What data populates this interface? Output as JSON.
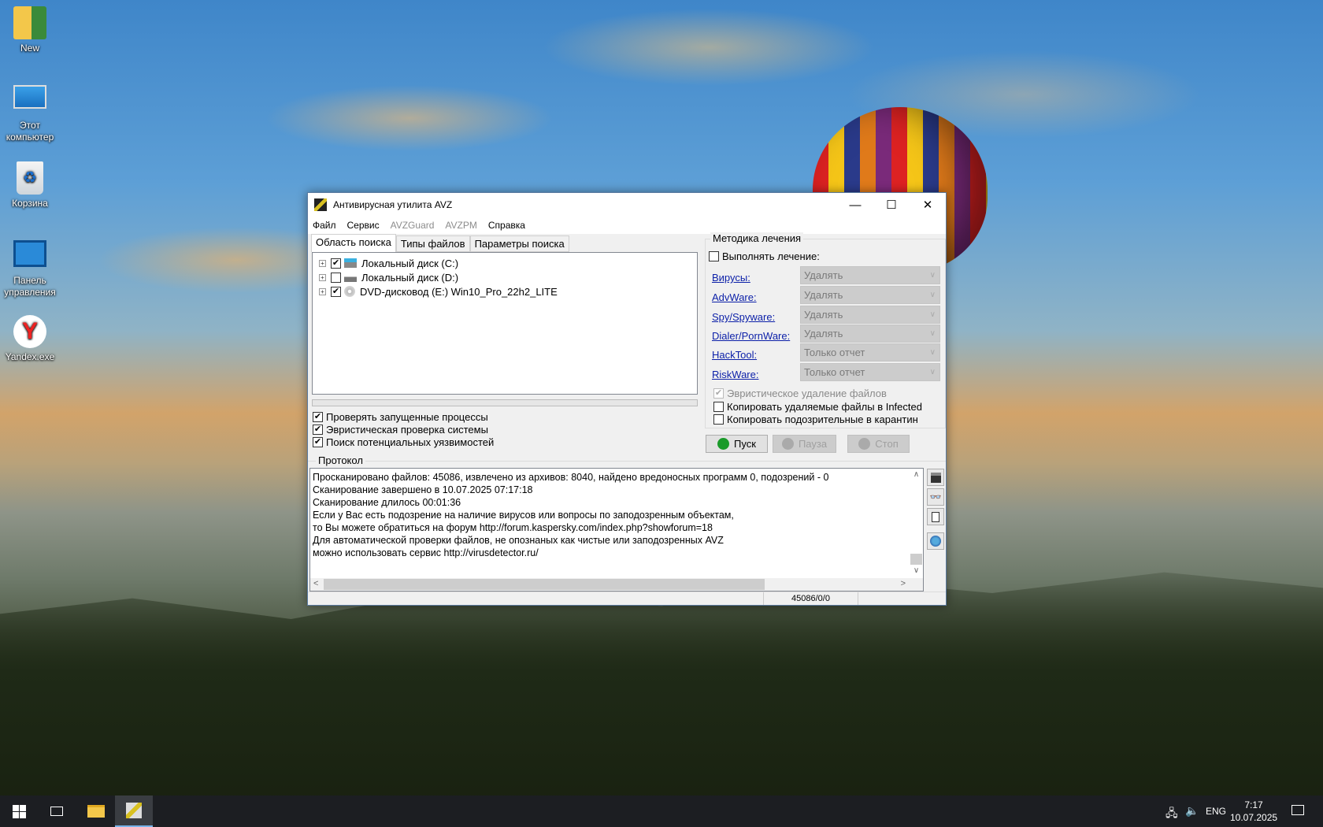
{
  "desktop": {
    "icons": [
      {
        "label": "New",
        "icon": "user-folder-icon"
      },
      {
        "label": "Этот компьютер",
        "icon": "computer-icon"
      },
      {
        "label": "Корзина",
        "icon": "recycle-bin-icon"
      },
      {
        "label": "Панель управления",
        "icon": "control-panel-icon"
      },
      {
        "label": "Yandex.exe",
        "icon": "yandex-installer-icon"
      }
    ]
  },
  "window": {
    "title": "Антивирусная утилита AVZ",
    "menu": [
      "Файл",
      "Сервис",
      "AVZGuard",
      "AVZPM",
      "Справка"
    ],
    "tabs": [
      "Область поиска",
      "Типы файлов",
      "Параметры поиска"
    ],
    "tree": [
      {
        "label": "Локальный диск (C:)",
        "checked": true
      },
      {
        "label": "Локальный диск (D:)",
        "checked": false
      },
      {
        "label": "DVD-дисковод (E:) Win10_Pro_22h2_LITE",
        "checked": true
      }
    ],
    "progress": 0,
    "options": [
      "Проверять запущенные процессы",
      "Эвристическая проверка системы",
      "Поиск потенциальных уязвимостей"
    ],
    "treatment": {
      "title": "Методика лечения",
      "perform": "Выполнять лечение:",
      "rows": [
        {
          "label": "Вирусы:",
          "value": "Удалять"
        },
        {
          "label": "AdvWare:",
          "value": "Удалять"
        },
        {
          "label": "Spy/Spyware:",
          "value": "Удалять"
        },
        {
          "label": "Dialer/PornWare:",
          "value": "Удалять"
        },
        {
          "label": "HackTool:",
          "value": "Только отчет"
        },
        {
          "label": "RiskWare:",
          "value": "Только отчет"
        }
      ],
      "heuristic": "Эвристическое удаление файлов",
      "copy_infected": "Копировать удаляемые файлы в  Infected",
      "copy_quarantine": "Копировать подозрительные в  карантин"
    },
    "buttons": {
      "start": "Пуск",
      "pause": "Пауза",
      "stop": "Стоп"
    },
    "protocol": {
      "title": "Протокол",
      "lines": [
        "Просканировано файлов: 45086, извлечено из архивов: 8040, найдено вредоносных программ 0, подозрений - 0",
        "Сканирование завершено в 10.07.2025 07:17:18",
        "Сканирование длилось 00:01:36",
        "Если у Вас есть подозрение на наличие вирусов или вопросы по заподозренным объектам,",
        "то Вы можете обратиться на форум http://forum.kaspersky.com/index.php?showforum=18",
        "Для автоматической проверки файлов, не опознаных как чистые или заподозренных AVZ",
        "можно использовать сервис http://virusdetector.ru/"
      ]
    },
    "status": "45086/0/0"
  },
  "taskbar": {
    "lang": "ENG",
    "time": "7:17",
    "date": "10.07.2025"
  },
  "colors": {
    "link": "#0b1fa8",
    "start_green": "#1a9a2a"
  }
}
